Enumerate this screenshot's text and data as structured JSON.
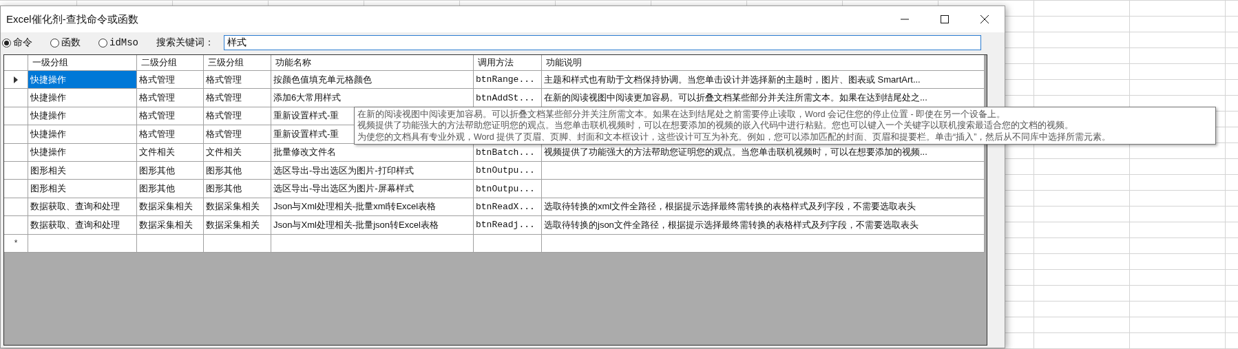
{
  "window": {
    "title": "Excel催化剂-查找命令或函数"
  },
  "search_types": [
    {
      "label": "命令",
      "selected": true
    },
    {
      "label": "函数",
      "selected": false
    },
    {
      "label": "idMso",
      "selected": false
    }
  ],
  "search": {
    "label": "搜索关键词：",
    "value": "样式"
  },
  "table": {
    "columns": [
      "一级分组",
      "二级分组",
      "三级分组",
      "功能名称",
      "调用方法",
      "功能说明"
    ],
    "rows": [
      {
        "selected": true,
        "cells": [
          "快捷操作",
          "格式管理",
          "格式管理",
          "按颜色值填充单元格颜色",
          "btnRange...",
          "主题和样式也有助于文档保持协调。当您单击设计并选择新的主题时，图片、图表或 SmartArt..."
        ]
      },
      {
        "selected": false,
        "cells": [
          "快捷操作",
          "格式管理",
          "格式管理",
          "添加6大常用样式",
          "btnAddSt...",
          "在新的阅读视图中阅读更加容易。可以折叠文档某些部分并关注所需文本。如果在达到结尾处之..."
        ]
      },
      {
        "selected": false,
        "cells": [
          "快捷操作",
          "格式管理",
          "格式管理",
          "重新设置样式-重"
        ]
      },
      {
        "selected": false,
        "cells": [
          "快捷操作",
          "格式管理",
          "格式管理",
          "重新设置样式-重"
        ]
      },
      {
        "selected": false,
        "cells": [
          "快捷操作",
          "文件相关",
          "文件相关",
          "批量修改文件名",
          "btnBatch...",
          "视频提供了功能强大的方法帮助您证明您的观点。当您单击联机视频时，可以在想要添加的视频..."
        ]
      },
      {
        "selected": false,
        "cells": [
          "图形相关",
          "图形其他",
          "图形其他",
          "选区导出-导出选区为图片-打印样式",
          "btnOutpu..."
        ]
      },
      {
        "selected": false,
        "cells": [
          "图形相关",
          "图形其他",
          "图形其他",
          "选区导出-导出选区为图片-屏幕样式",
          "btnOutpu..."
        ]
      },
      {
        "selected": false,
        "cells": [
          "数据获取、查询和处理",
          "数据采集相关",
          "数据采集相关",
          "Json与Xml处理相关-批量xml转Excel表格",
          "btnReadX...",
          "选取待转换的xml文件全路径，根据提示选择最终需转换的表格样式及列字段，不需要选取表头"
        ]
      },
      {
        "selected": false,
        "cells": [
          "数据获取、查询和处理",
          "数据采集相关",
          "数据采集相关",
          "Json与Xml处理相关-批量json转Excel表格",
          "btnReadj...",
          "选取待转换的json文件全路径，根据提示选择最终需转换的表格样式及列字段，不需要选取表头"
        ]
      }
    ],
    "new_row_marker": "*"
  },
  "tooltip": {
    "lines": [
      "在新的阅读视图中阅读更加容易。可以折叠文档某些部分并关注所需文本。如果在达到结尾处之前需要停止读取，Word 会记住您的停止位置 - 即使在另一个设备上。",
      "视频提供了功能强大的方法帮助您证明您的观点。当您单击联机视频时，可以在想要添加的视频的嵌入代码中进行粘贴。您也可以键入一个关键字以联机搜索最适合您的文档的视频。",
      "为使您的文档具有专业外观，Word 提供了页眉、页脚、封面和文本框设计，这些设计可互为补充。例如，您可以添加匹配的封面、页眉和提要栏。单击“插入”，然后从不同库中选择所需元素。"
    ]
  }
}
